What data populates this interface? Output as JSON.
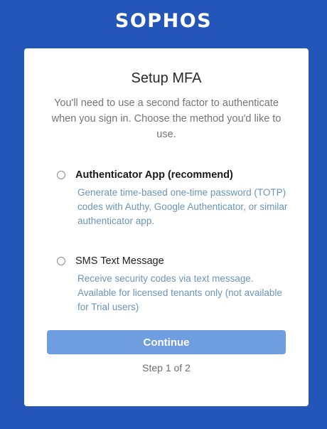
{
  "brand": {
    "logo_text": "SOPHOS"
  },
  "card": {
    "title": "Setup MFA",
    "intro": "You'll need to use a second factor to authenticate when you sign in. Choose the method you'd like to use.",
    "options": [
      {
        "label": "Authenticator App (recommend)",
        "description": "Generate time-based one-time password (TOTP) codes with Authy, Google Authenticator, or similar authenticator app.",
        "selected": false
      },
      {
        "label": "SMS Text Message",
        "description": "Receive security codes via text message. Available for licensed tenants only (not available for Trial users)",
        "selected": false
      }
    ],
    "continue_label": "Continue",
    "step_text": "Step 1 of 2"
  },
  "colors": {
    "background": "#2356b8",
    "button": "#6f9ee0",
    "description_text": "#6a95b8"
  }
}
